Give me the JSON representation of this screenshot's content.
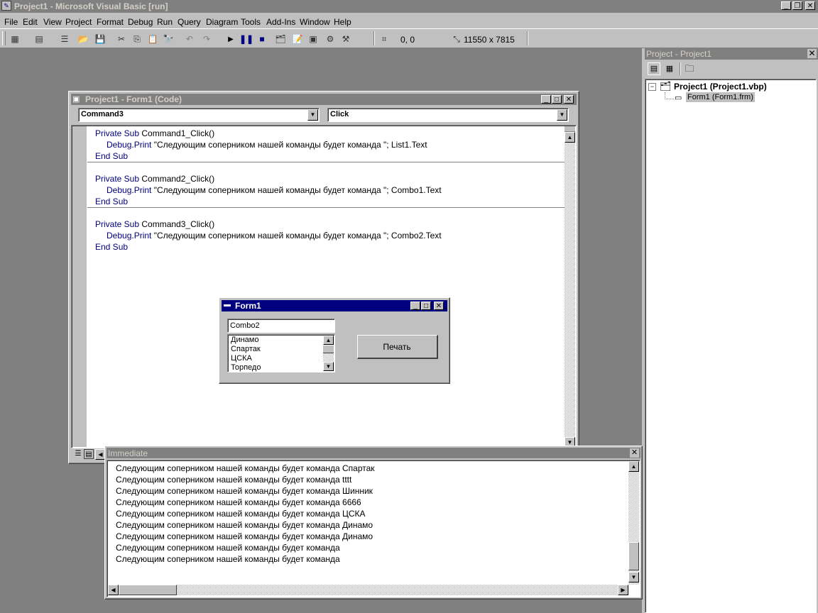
{
  "app": {
    "title": "Project1 - Microsoft Visual Basic [run]"
  },
  "menu": [
    {
      "label": "File"
    },
    {
      "label": "Edit"
    },
    {
      "label": "View"
    },
    {
      "label": "Project"
    },
    {
      "label": "Format"
    },
    {
      "label": "Debug"
    },
    {
      "label": "Run"
    },
    {
      "label": "Query"
    },
    {
      "label": "Diagram"
    },
    {
      "label": "Tools"
    },
    {
      "label": "Add-Ins"
    },
    {
      "label": "Window"
    },
    {
      "label": "Help"
    }
  ],
  "toolbar": {
    "position_readout": "0, 0",
    "size_readout": "11550 x 7815"
  },
  "code_window": {
    "title": "Project1 - Form1 (Code)",
    "object_combo": "Command3",
    "proc_combo": "Click",
    "lines": [
      {
        "kw1": "Private Sub",
        "rest1": " Command1_Click()"
      },
      {
        "kw1": "Debug.Print",
        "rest1": " \"Следующим соперником нашей команды будет команда \"; List1.Text"
      },
      {
        "kw1": "End Sub",
        "rest1": ""
      },
      {
        "kw1": "Private Sub",
        "rest1": " Command2_Click()"
      },
      {
        "kw1": "Debug.Print",
        "rest1": " \"Следующим соперником нашей команды будет команда \"; Combo1.Text"
      },
      {
        "kw1": "End Sub",
        "rest1": ""
      },
      {
        "kw1": "Private Sub",
        "rest1": " Command3_Click()"
      },
      {
        "kw1": "Debug.Print",
        "rest1": " \"Следующим соперником нашей команды будет команда \"; Combo2.Text"
      },
      {
        "kw1": "End Sub",
        "rest1": ""
      }
    ]
  },
  "form1": {
    "title": "Form1",
    "combo_value": "Combo2",
    "list_items": [
      "Динамо",
      "Спартак",
      "ЦСКА",
      "Торпедо"
    ],
    "button_label": "Печать"
  },
  "immediate": {
    "title": "Immediate",
    "lines": [
      "Следующим соперником нашей команды будет команда Спартак",
      "Следующим соперником нашей команды будет команда tttt",
      "Следующим соперником нашей команды будет команда Шинник",
      "Следующим соперником нашей команды будет команда 6666",
      "Следующим соперником нашей команды будет команда ЦСКА",
      "Следующим соперником нашей команды будет команда Динамо",
      "Следующим соперником нашей команды будет команда Динамо",
      "Следующим соперником нашей команды будет команда",
      "Следующим соперником нашей команды будет команда"
    ]
  },
  "project_explorer": {
    "title": "Project - Project1",
    "root": "Project1 (Project1.vbp)",
    "child": "Form1 (Form1.frm)"
  }
}
